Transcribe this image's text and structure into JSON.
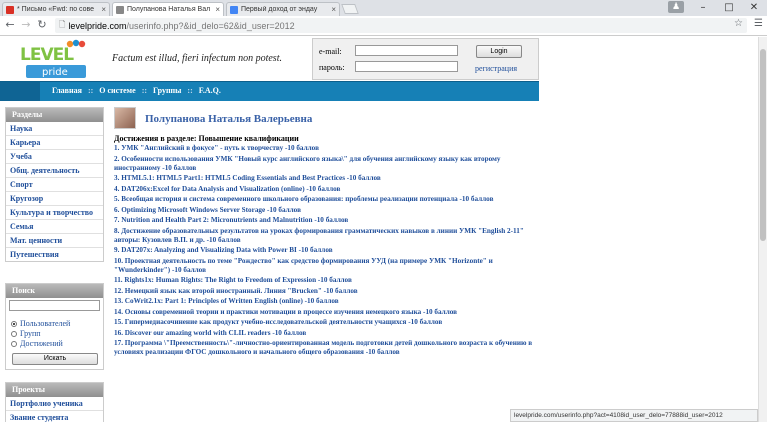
{
  "browser": {
    "tabs": [
      {
        "title": "* Письмо «Fwd: по сове",
        "favicon_color": "#d93025",
        "active": false
      },
      {
        "title": "Полупанова Наталья Вал",
        "favicon_color": "#888888",
        "active": true
      },
      {
        "title": "Первый доход от эндау",
        "favicon_color": "#4285f4",
        "active": false
      }
    ],
    "tab_close_glyph": "×",
    "window_controls": {
      "minimize": "–",
      "maximize": "□",
      "close": "✕"
    },
    "url_domain": "levelpride.com",
    "url_path": "/userinfo.php?&id_delo=62&id_user=2012",
    "status_url": "levelpride.com/userinfo.php?act=4108id_user_delo=77888id_user=2012"
  },
  "site": {
    "logo_top": "LEVEL",
    "logo_bottom": "pride",
    "tagline": "Factum est illud, fieri infectum non potest.",
    "login": {
      "email_label": "e-mail:",
      "password_label": "пароль:",
      "button": "Login",
      "register": "регистрация"
    },
    "nav": [
      "Главная",
      "О системе",
      "Группы",
      "F.A.Q."
    ],
    "nav_separator": "::"
  },
  "sidebar": {
    "sections_title": "Разделы",
    "sections": [
      "Наука",
      "Карьера",
      "Учеба",
      "Общ. деятельность",
      "Спорт",
      "Кругозор",
      "Культура и творчество",
      "Семья",
      "Мат. ценности",
      "Путешествия"
    ],
    "search_title": "Поиск",
    "search_options": [
      "Пользователей",
      "Групп",
      "Достижений"
    ],
    "search_button": "Искать",
    "projects_title": "Проекты",
    "projects": [
      "Портфолио ученика",
      "Звание студента"
    ]
  },
  "profile": {
    "name": "Полупанова Наталья Валерьевна",
    "achievements_header": "Достижения в разделе: Повышение квалификации",
    "achievements": [
      "1. УМК \"Английский в фокусе\" - путь к творчеству -10 баллов",
      "2. Особенности использования УМК \"Новый курс английского языка\\\" для обучения английскому языку как второму иностранному -10 баллов",
      "3. HTML5.1: HTML5 Part1: HTML5 Coding Essentials and Best Practices -10 баллов",
      "4. DAT206x:Excel for Data Analysis and Visualization (online) -10 баллов",
      "5. Всеобщая история и система современного школьного образования: проблемы реализации потенциала -10 баллов",
      "6. Optimizing Microsoft Windows Server Storage -10 баллов",
      "7. Nutrition and Health Part 2: Micronutrients and Malnutrition -10 баллов",
      "8. Достижение образовательных результатов на уроках формирования грамматических навыков в линии УМК \"English 2-11\" авторы: Кузовлев В.П. и др. -10 баллов",
      "9. DAT207x: Analyzing and Visualizing Data with Power BI -10 баллов",
      "10. Проектная деятельность по теме \"Рождество\" как средство формирования УУД (на примере УМК \"Horizonte\" и \"Wunderkinder\") -10 баллов",
      "11. Rights1x: Human Rights: The Right to Freedom of Expression -10 баллов",
      "12. Немецкий язык как второй иностранный. Линия \"Brucken\" -10 баллов",
      "13. CoWrit2.1x: Part 1: Principles of Written English (online) -10 баллов",
      "14. Основы современной теории и практики мотивации в процессе изучения немецкого языка -10 баллов",
      "15. Гипермедиасочинение как продукт учебно-исследовательской деятельности учащихся -10 баллов",
      "16. Discover our amazing world with CLIL readers -10 баллов",
      "17. Программа \\\"Преемственность\\\"-личностно-ориентированная модель подготовки детей дошкольного возраста к обучению в условиях реализации ФГОС дошкольного и начального общего образования -10 баллов"
    ]
  }
}
